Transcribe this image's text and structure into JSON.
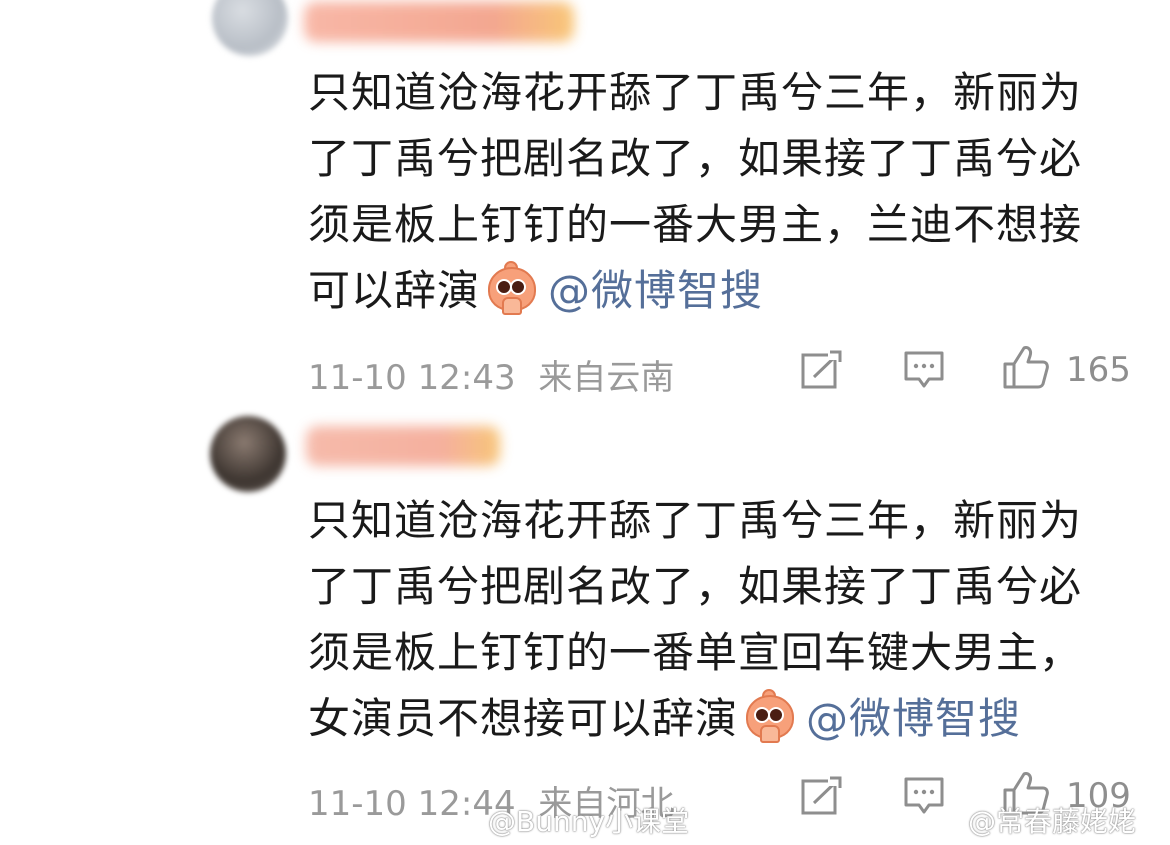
{
  "comments": [
    {
      "text": "只知道沧海花开舔了丁禹兮三年，新丽为了丁禹兮把剧名改了，如果接了丁禹兮必须是板上钉钉的一番大男主，兰迪不想接可以辞演",
      "line1": "只知道沧海花开舔了丁禹兮三年，新丽为",
      "line2": "了丁禹兮把剧名改了，如果接了丁禹兮必",
      "line3": "须是板上钉钉的一番大男主，兰迪不想接",
      "line4": "可以辞演",
      "emoji": "pleading-face-emoji",
      "mention": "@微博智搜",
      "time": "11-10 12:43",
      "location": "来自云南",
      "likes": "165"
    },
    {
      "text": "只知道沧海花开舔了丁禹兮三年，新丽为了丁禹兮把剧名改了，如果接了丁禹兮必须是板上钉钉的一番单宣回车键大男主，女演员不想接可以辞演",
      "line1": "只知道沧海花开舔了丁禹兮三年，新丽为",
      "line2": "了丁禹兮把剧名改了，如果接了丁禹兮必",
      "line3": "须是板上钉钉的一番单宣回车键大男主，",
      "line4": "女演员不想接可以辞演",
      "emoji": "pleading-face-emoji",
      "mention": "@微博智搜",
      "time": "11-10 12:44",
      "location": "来自河北",
      "likes": "109"
    }
  ],
  "icons": {
    "share": "share-icon",
    "comment": "comment-icon",
    "like": "thumbs-up-icon",
    "weibo": "weibo-logo-icon"
  },
  "watermarks": {
    "left": "@Bunny小课堂",
    "right": "@常春藤姥姥"
  },
  "colors": {
    "text": "#1a1a1a",
    "mention": "#556f99",
    "meta": "#9a9a9a"
  }
}
